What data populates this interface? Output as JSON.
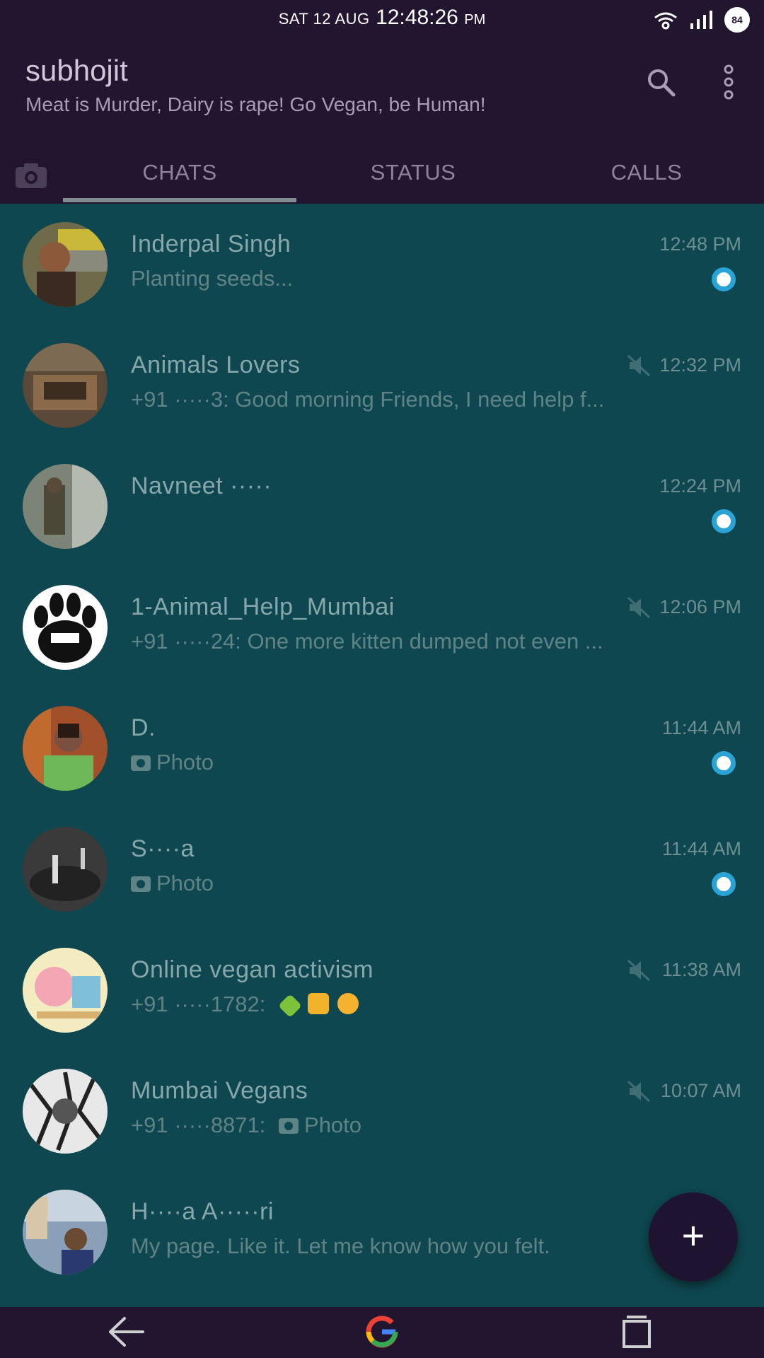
{
  "status_bar": {
    "day": "SAT 12 AUG",
    "time": "12:48:26",
    "ampm": "PM",
    "battery": "84",
    "icons": [
      "wifi-icon",
      "signal-icon",
      "battery-icon"
    ]
  },
  "header": {
    "name": "subhojit",
    "tagline": "Meat is Murder, Dairy is rape! Go Vegan, be Human!",
    "icons": [
      "search-icon",
      "more-vert-icon"
    ]
  },
  "tabs": [
    {
      "label": "CHATS",
      "active": true
    },
    {
      "label": "STATUS",
      "active": false
    },
    {
      "label": "CALLS",
      "active": false
    }
  ],
  "chats": [
    {
      "title": "Inderpal Singh",
      "time": "12:48 PM",
      "preview": "Planting seeds...",
      "muted": false,
      "status_dot": true
    },
    {
      "title": "Animals Lovers",
      "time": "12:32 PM",
      "preview": "+91 ·····3: Good morning Friends, I need help f...",
      "muted": true,
      "status_dot": false
    },
    {
      "title": "Navneet ·····",
      "time": "12:24 PM",
      "preview": "",
      "muted": false,
      "status_dot": true
    },
    {
      "title": "1-Animal_Help_Mumbai",
      "time": "12:06 PM",
      "preview": "+91 ·····24: One more kitten dumped not even ...",
      "muted": true,
      "status_dot": false
    },
    {
      "title": "D.",
      "time": "11:44 AM",
      "preview": "Photo",
      "muted": false,
      "status_dot": true
    },
    {
      "title": "S····a",
      "time": "11:44 AM",
      "preview": "Photo",
      "muted": false,
      "status_dot": true
    },
    {
      "title": "Online vegan activism",
      "time": "11:38 AM",
      "preview": "+91 ·····1782:",
      "muted": true,
      "status_dot": false
    },
    {
      "title": "Mumbai Vegans",
      "time": "10:07 AM",
      "preview": "+91 ·····8871:",
      "preview_extra": "Photo",
      "muted": true,
      "status_dot": false
    },
    {
      "title": "H····a A·····ri",
      "time": "",
      "preview": "My page. Like it. Let me know how you felt.",
      "muted": false,
      "status_dot": false
    }
  ],
  "fab": {
    "label": "+"
  },
  "colors": {
    "header_bg": "#221530",
    "list_bg": "#0e474f",
    "status_ring": "#2aa3d6",
    "title_text": "#86a8ac",
    "preview_text": "#5f8488"
  }
}
